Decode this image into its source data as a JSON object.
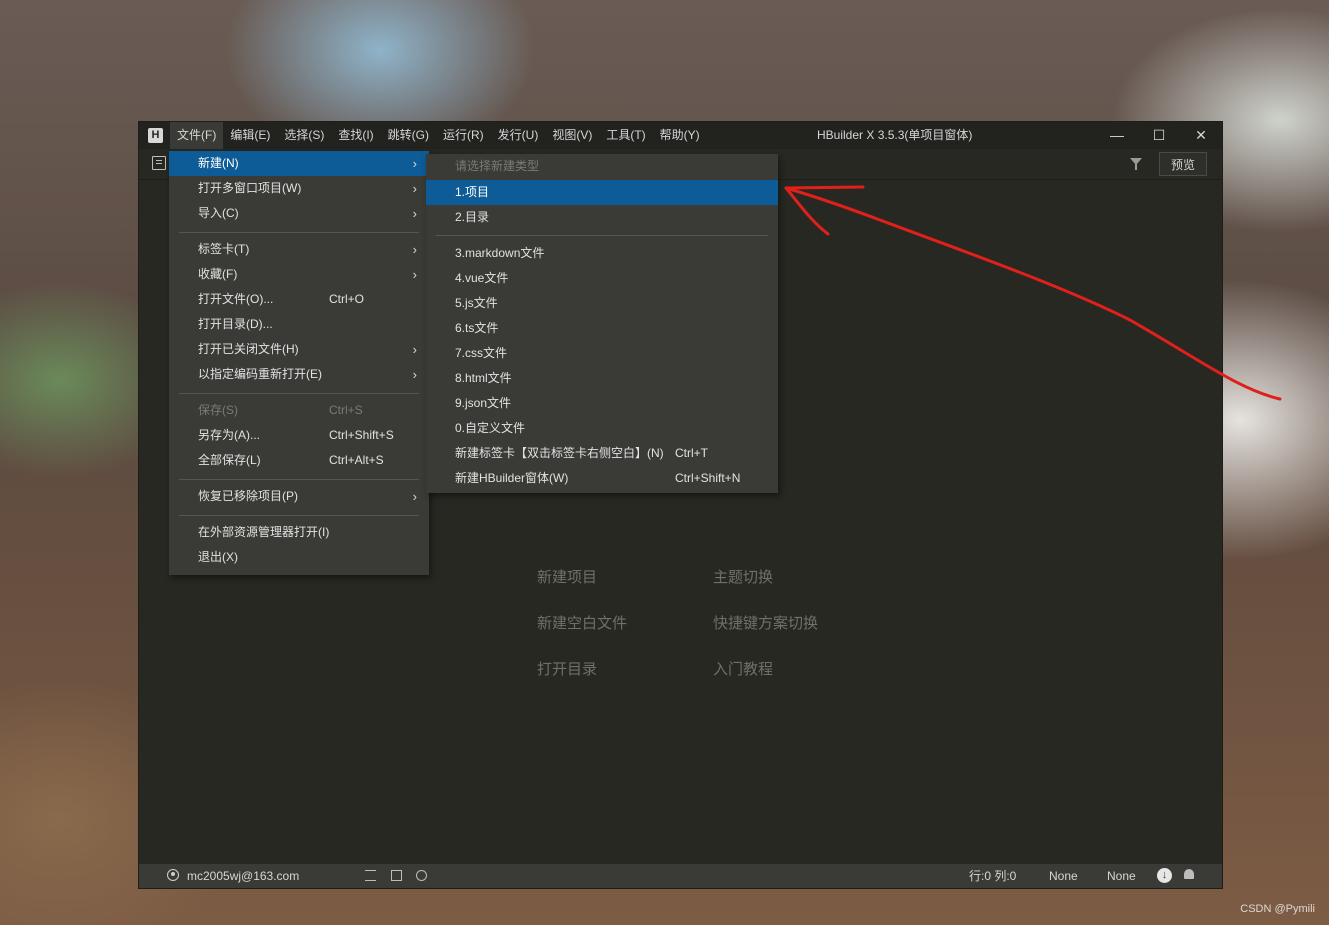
{
  "window": {
    "title": "HBuilder X 3.5.3(单项目窗体)",
    "logo": "H",
    "menus": [
      "文件(F)",
      "编辑(E)",
      "选择(S)",
      "查找(I)",
      "跳转(G)",
      "运行(R)",
      "发行(U)",
      "视图(V)",
      "工具(T)",
      "帮助(Y)"
    ],
    "controls": {
      "minimize": "—",
      "maximize": "☐",
      "close": "✕"
    }
  },
  "toolbar": {
    "preview_label": "预览"
  },
  "file_menu": {
    "items": [
      {
        "label": "新建(N)",
        "shortcut": "",
        "submenu": true,
        "highlighted": true
      },
      {
        "label": "打开多窗口项目(W)",
        "shortcut": "",
        "submenu": true
      },
      {
        "label": "导入(C)",
        "shortcut": "",
        "submenu": true
      },
      {
        "label": "标签卡(T)",
        "shortcut": "",
        "submenu": true
      },
      {
        "label": "收藏(F)",
        "shortcut": "",
        "submenu": true
      },
      {
        "label": "打开文件(O)...",
        "shortcut": "Ctrl+O"
      },
      {
        "label": "打开目录(D)...",
        "shortcut": ""
      },
      {
        "label": "打开已关闭文件(H)",
        "shortcut": "",
        "submenu": true
      },
      {
        "label": "以指定编码重新打开(E)",
        "shortcut": "",
        "submenu": true
      },
      {
        "label": "保存(S)",
        "shortcut": "Ctrl+S",
        "disabled": true
      },
      {
        "label": "另存为(A)...",
        "shortcut": "Ctrl+Shift+S"
      },
      {
        "label": "全部保存(L)",
        "shortcut": "Ctrl+Alt+S"
      },
      {
        "label": "恢复已移除项目(P)",
        "shortcut": "",
        "submenu": true
      },
      {
        "label": "在外部资源管理器打开(I)",
        "shortcut": ""
      },
      {
        "label": "退出(X)",
        "shortcut": ""
      }
    ]
  },
  "new_submenu": {
    "header": "请选择新建类型",
    "items": [
      {
        "label": "1.项目",
        "shortcut": "",
        "highlighted": true
      },
      {
        "label": "2.目录",
        "shortcut": ""
      },
      {
        "label": "3.markdown文件",
        "shortcut": ""
      },
      {
        "label": "4.vue文件",
        "shortcut": ""
      },
      {
        "label": "5.js文件",
        "shortcut": ""
      },
      {
        "label": "6.ts文件",
        "shortcut": ""
      },
      {
        "label": "7.css文件",
        "shortcut": ""
      },
      {
        "label": "8.html文件",
        "shortcut": ""
      },
      {
        "label": "9.json文件",
        "shortcut": ""
      },
      {
        "label": "0.自定义文件",
        "shortcut": ""
      },
      {
        "label": "新建标签卡【双击标签卡右侧空白】(N)",
        "shortcut": "Ctrl+T"
      },
      {
        "label": "新建HBuilder窗体(W)",
        "shortcut": "Ctrl+Shift+N"
      }
    ]
  },
  "welcome": {
    "new_project": "新建项目",
    "theme_switch": "主题切换",
    "new_blank_file": "新建空白文件",
    "keymap_switch": "快捷键方案切换",
    "open_dir": "打开目录",
    "tutorial": "入门教程"
  },
  "statusbar": {
    "account": "mc2005wj@163.com",
    "line_col": "行:0  列:0",
    "encoding": "None",
    "syntax": "None",
    "download_glyph": "↓"
  },
  "watermark": "CSDN @Pymili",
  "colors": {
    "menu_highlight": "#0d5c97",
    "annotation_arrow": "#e0201a",
    "editor_bg": "#272822"
  },
  "icons": [
    "app-logo-icon",
    "explorer-icon",
    "filter-icon",
    "avatar-icon",
    "list-icon",
    "terminal-icon",
    "globe-icon",
    "download-icon",
    "bell-icon",
    "submenu-arrow-icon"
  ]
}
